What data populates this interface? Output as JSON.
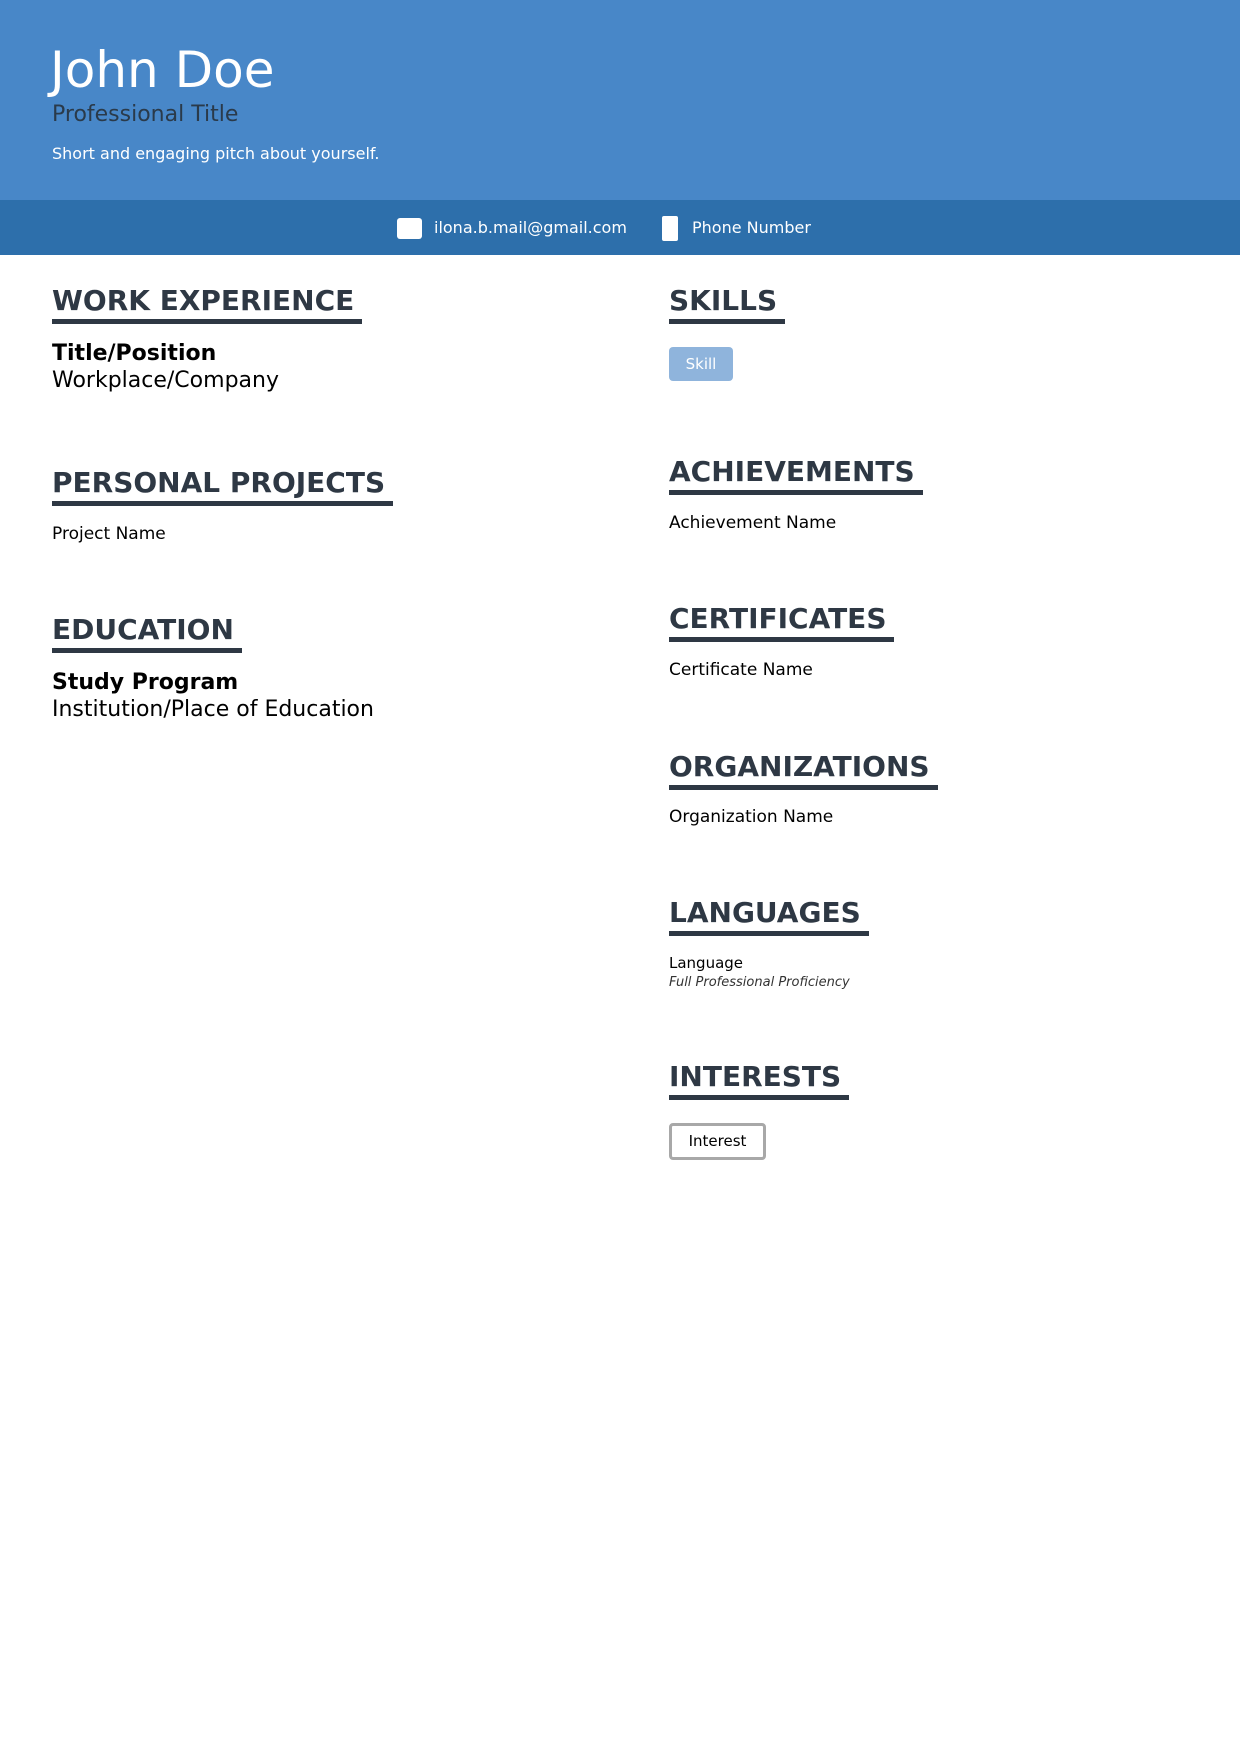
{
  "header": {
    "name": "John Doe",
    "professional_title": "Professional Title",
    "pitch": "Short and engaging pitch about yourself."
  },
  "contact": {
    "email": "ilona.b.mail@gmail.com",
    "phone": "Phone Number",
    "email_icon": "envelope-icon",
    "phone_icon": "phone-icon"
  },
  "left": {
    "work_experience": {
      "heading": "WORK EXPERIENCE",
      "title": "Title/Position",
      "company": "Workplace/Company"
    },
    "personal_projects": {
      "heading": "PERSONAL PROJECTS",
      "project": "Project Name"
    },
    "education": {
      "heading": "EDUCATION",
      "program": "Study Program",
      "institution": "Institution/Place of Education"
    }
  },
  "right": {
    "skills": {
      "heading": "SKILLS",
      "items": [
        "Skill"
      ]
    },
    "achievements": {
      "heading": "ACHIEVEMENTS",
      "item": "Achievement Name"
    },
    "certificates": {
      "heading": "CERTIFICATES",
      "item": "Certificate Name"
    },
    "organizations": {
      "heading": "ORGANIZATIONS",
      "item": "Organization Name"
    },
    "languages": {
      "heading": "LANGUAGES",
      "language": "Language",
      "proficiency": "Full Professional Proficiency"
    },
    "interests": {
      "heading": "INTERESTS",
      "items": [
        "Interest"
      ]
    }
  },
  "colors": {
    "header_bg": "#4887c8",
    "contact_bar_bg": "#2d6fab",
    "heading_text": "#2e3844",
    "skill_tag_bg": "#8fb4dc"
  }
}
